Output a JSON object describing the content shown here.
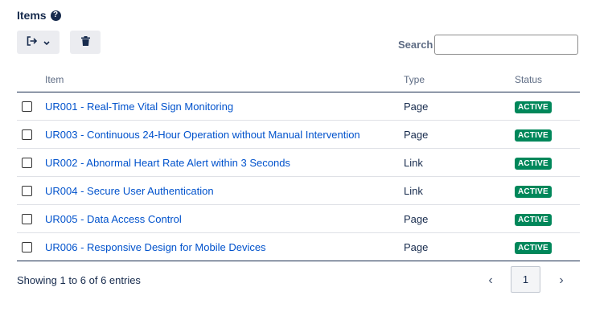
{
  "header": {
    "title": "Items",
    "help_glyph": "?"
  },
  "toolbar": {
    "export_icon": "sign-out-icon",
    "chevron_icon": "chevron-down-icon",
    "delete_icon": "trash-icon"
  },
  "search": {
    "label": "Search",
    "value": "",
    "placeholder": ""
  },
  "table": {
    "columns": [
      "Item",
      "Type",
      "Status"
    ],
    "rows": [
      {
        "item": "UR001 - Real-Time Vital Sign Monitoring",
        "type": "Page",
        "status": "ACTIVE"
      },
      {
        "item": "UR003 - Continuous 24-Hour Operation without Manual Intervention",
        "type": "Page",
        "status": "ACTIVE"
      },
      {
        "item": "UR002 - Abnormal Heart Rate Alert within 3 Seconds",
        "type": "Link",
        "status": "ACTIVE"
      },
      {
        "item": "UR004 - Secure User Authentication",
        "type": "Link",
        "status": "ACTIVE"
      },
      {
        "item": "UR005 - Data Access Control",
        "type": "Page",
        "status": "ACTIVE"
      },
      {
        "item": "UR006 - Responsive Design for Mobile Devices",
        "type": "Page",
        "status": "ACTIVE"
      }
    ]
  },
  "footer": {
    "info": "Showing 1 to 6 of 6 entries",
    "prev": "‹",
    "page": "1",
    "next": "›"
  },
  "colors": {
    "status_active": "#00875a",
    "link": "#0052cc",
    "text": "#172b4d"
  }
}
